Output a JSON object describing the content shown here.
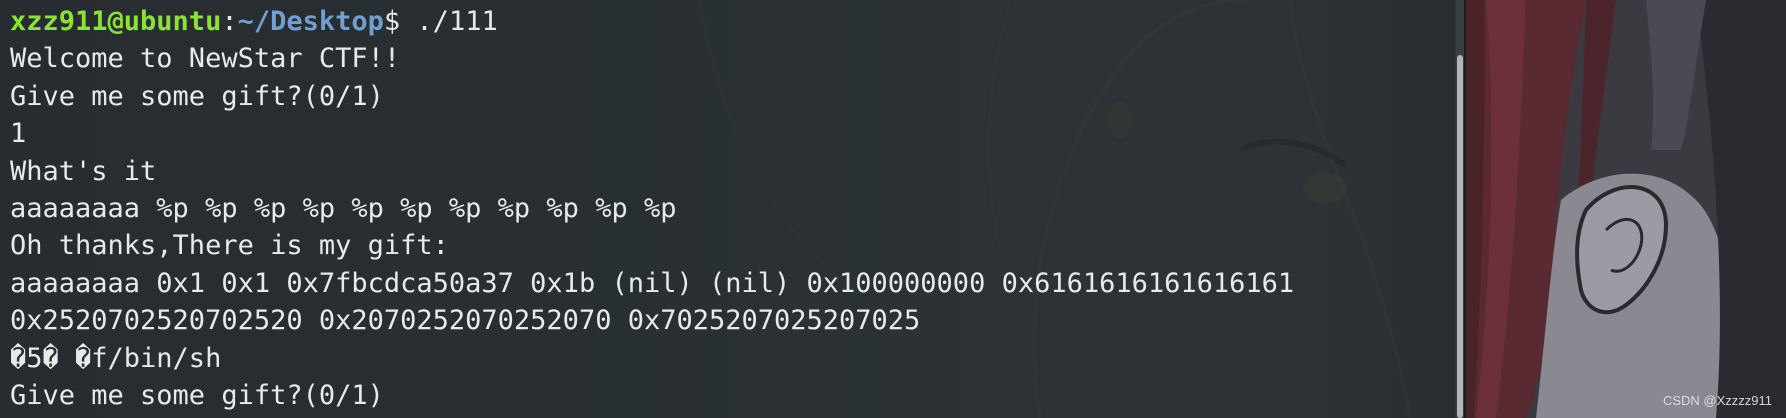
{
  "terminal": {
    "prompt": {
      "user_host": "xzz911@ubuntu",
      "colon": ":",
      "path": "~/Desktop",
      "symbol": "$",
      "command": " ./111"
    },
    "lines": [
      "Welcome to NewStar CTF!!",
      "Give me some gift?(0/1)",
      "1",
      "What's it",
      "aaaaaaaa %p %p %p %p %p %p %p %p %p %p %p",
      "Oh thanks,There is my gift:",
      "aaaaaaaa 0x1 0x1 0x7fbcdca50a37 0x1b (nil) (nil) 0x100000000 0x6161616161616161",
      "0x2520702520702520 0x2070252070252070 0x7025207025207025",
      "�5� �f/bin/sh",
      "Give me some gift?(0/1)"
    ],
    "colors": {
      "user": "#8ae234",
      "path": "#729fcf",
      "text": "#e8eaea"
    }
  },
  "watermark": "CSDN @Xzzzz911"
}
